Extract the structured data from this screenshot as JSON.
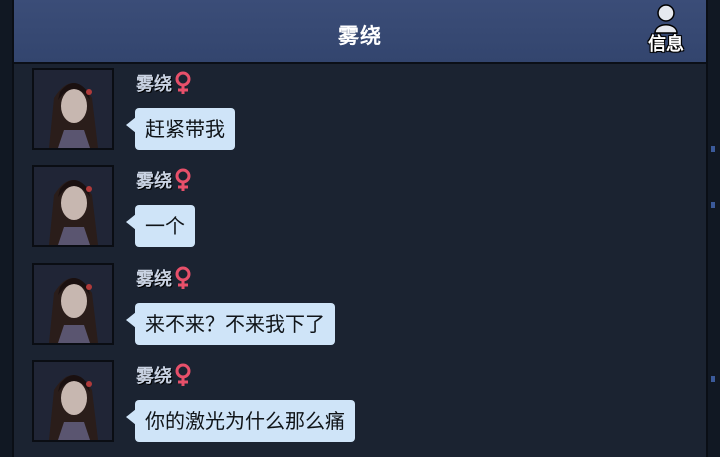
{
  "header": {
    "title": "雾绕",
    "info_label": "信息",
    "info_icon": "person-icon"
  },
  "colors": {
    "header_bg": "#3b4d78",
    "panel_bg": "#1b2331",
    "bubble_bg": "#cfe4f8",
    "female_icon": "#e8506a"
  },
  "messages": [
    {
      "sender": "雾绕",
      "gender_icon": "female-icon",
      "text": "赶紧带我"
    },
    {
      "sender": "雾绕",
      "gender_icon": "female-icon",
      "text": "一个"
    },
    {
      "sender": "雾绕",
      "gender_icon": "female-icon",
      "text": "来不来？不来我下了"
    },
    {
      "sender": "雾绕",
      "gender_icon": "female-icon",
      "text": "你的激光为什么那么痛"
    }
  ]
}
